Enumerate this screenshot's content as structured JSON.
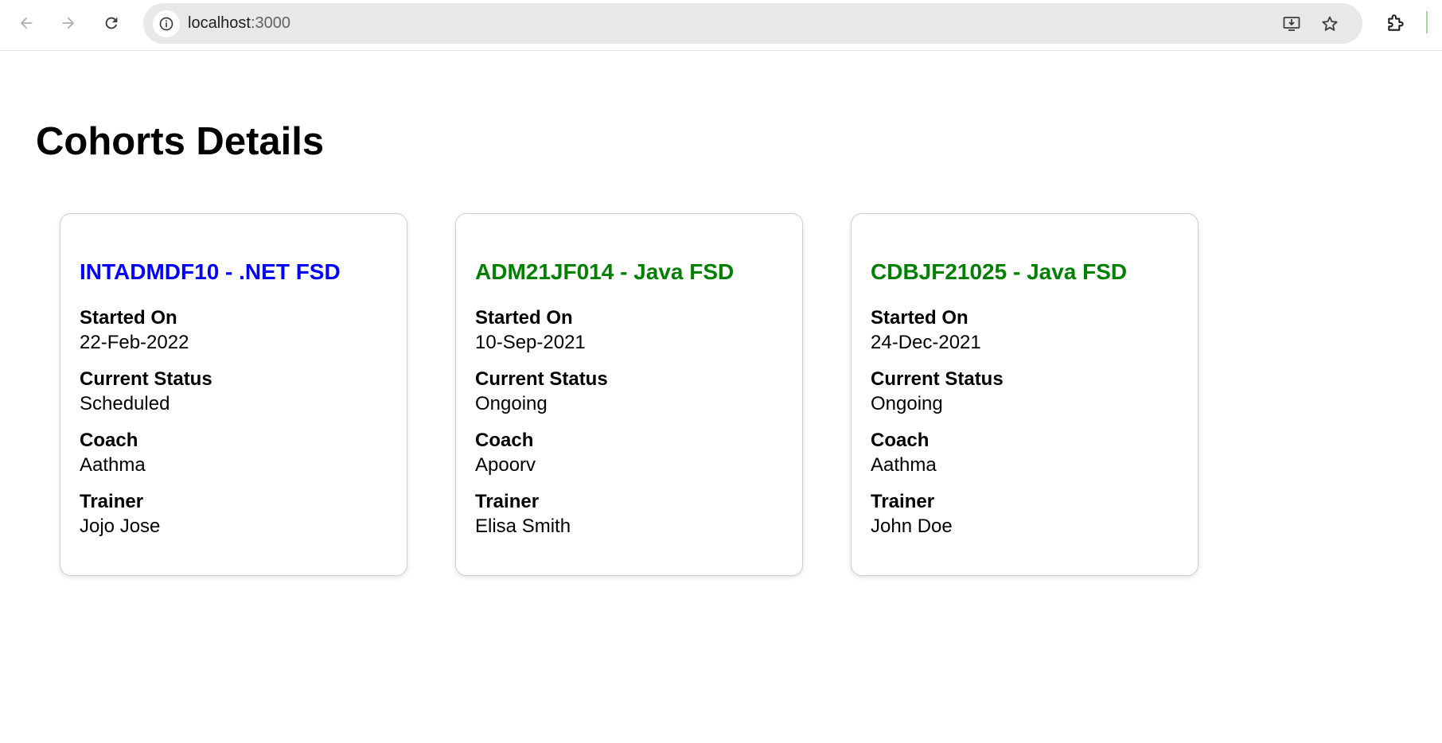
{
  "browser": {
    "url_host": "localhost",
    "url_port": ":3000",
    "icons": {
      "back": "arrow-left-icon",
      "forward": "arrow-right-icon",
      "reload": "reload-icon",
      "site_info": "info-icon",
      "install": "install-app-icon",
      "bookmark": "star-icon",
      "extensions": "puzzle-icon"
    }
  },
  "page": {
    "title": "Cohorts Details"
  },
  "labels": {
    "started_on": "Started On",
    "current_status": "Current Status",
    "coach": "Coach",
    "trainer": "Trainer"
  },
  "cohorts": [
    {
      "title": "INTADMDF10 - .NET FSD",
      "title_color": "#0000ff",
      "started_on": "22-Feb-2022",
      "current_status": "Scheduled",
      "coach": "Aathma",
      "trainer": "Jojo Jose"
    },
    {
      "title": "ADM21JF014 - Java FSD",
      "title_color": "#008000",
      "started_on": "10-Sep-2021",
      "current_status": "Ongoing",
      "coach": "Apoorv",
      "trainer": "Elisa Smith"
    },
    {
      "title": "CDBJF21025 - Java FSD",
      "title_color": "#008000",
      "started_on": "24-Dec-2021",
      "current_status": "Ongoing",
      "coach": "Aathma",
      "trainer": "John Doe"
    }
  ]
}
